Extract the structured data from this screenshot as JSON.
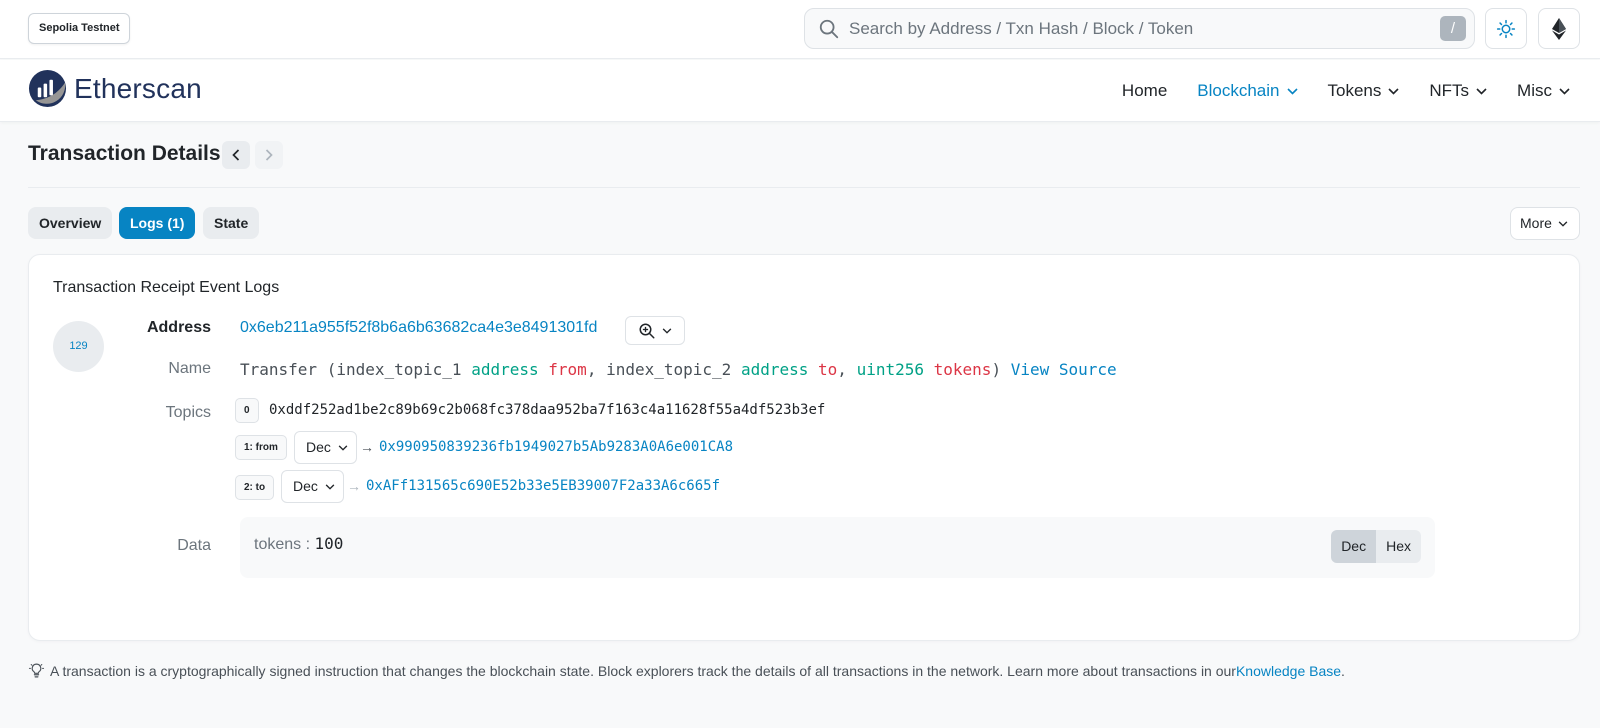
{
  "topbar": {
    "network": "Sepolia Testnet",
    "search_placeholder": "Search by Address / Txn Hash / Block / Token",
    "slash_key": "/"
  },
  "nav": {
    "logo_text": "Etherscan",
    "items": [
      {
        "label": "Home",
        "has_dropdown": false,
        "active": false
      },
      {
        "label": "Blockchain",
        "has_dropdown": true,
        "active": true
      },
      {
        "label": "Tokens",
        "has_dropdown": true,
        "active": false
      },
      {
        "label": "NFTs",
        "has_dropdown": true,
        "active": false
      },
      {
        "label": "Misc",
        "has_dropdown": true,
        "active": false
      }
    ]
  },
  "page": {
    "title": "Transaction Details",
    "tabs": [
      {
        "label": "Overview",
        "active": false
      },
      {
        "label": "Logs (1)",
        "active": true
      },
      {
        "label": "State",
        "active": false
      }
    ],
    "more_label": "More"
  },
  "log": {
    "section_title": "Transaction Receipt Event Logs",
    "index": "129",
    "labels": {
      "address": "Address",
      "name": "Name",
      "topics": "Topics",
      "data": "Data"
    },
    "address": "0x6eb211a955f52f8b6a6b63682ca4e3e8491301fd",
    "name": {
      "event": "Transfer",
      "open": " (",
      "p1_topic": "index_topic_1",
      "p1_type": "address",
      "p1_name": "from",
      "sep1": ", ",
      "p2_topic": "index_topic_2",
      "p2_type": "address",
      "p2_name": "to",
      "sep2": ", ",
      "p3_type": "uint256",
      "p3_name": "tokens",
      "close": ")",
      "view_source": "View Source"
    },
    "topics": [
      {
        "chip": "0",
        "value": "0xddf252ad1be2c89b69c2b068fc378daa952ba7f163c4a11628f55a4df523b3ef"
      },
      {
        "chip": "1: from",
        "format": "Dec",
        "arrow": "→",
        "value": "0x990950839236fb1949027b5Ab9283A0A6e001CA8"
      },
      {
        "chip": "2: to",
        "format": "Dec",
        "arrow": "→",
        "value": "0xAFf131565c690E52b33e5EB39007F2a33A6c665f"
      }
    ],
    "data": {
      "key": "tokens",
      "sep": " : ",
      "value": "100",
      "toggle": [
        "Dec",
        "Hex"
      ],
      "toggle_selected": "Dec"
    }
  },
  "footer": {
    "text": "A transaction is a cryptographically signed instruction that changes the blockchain state. Block explorers track the details of all transactions in the network. Learn more about transactions in our ",
    "link": "Knowledge Base",
    "end": "."
  },
  "colors": {
    "brand_blue": "#0784c3",
    "logo_navy": "#21325b",
    "param_type": "#00a186",
    "param_name": "#dc3545"
  },
  "icons": {
    "search": "search-icon",
    "theme": "sun-icon",
    "network": "ethereum-icon",
    "zoom": "zoom-in-icon",
    "hint": "lightbulb-icon"
  }
}
